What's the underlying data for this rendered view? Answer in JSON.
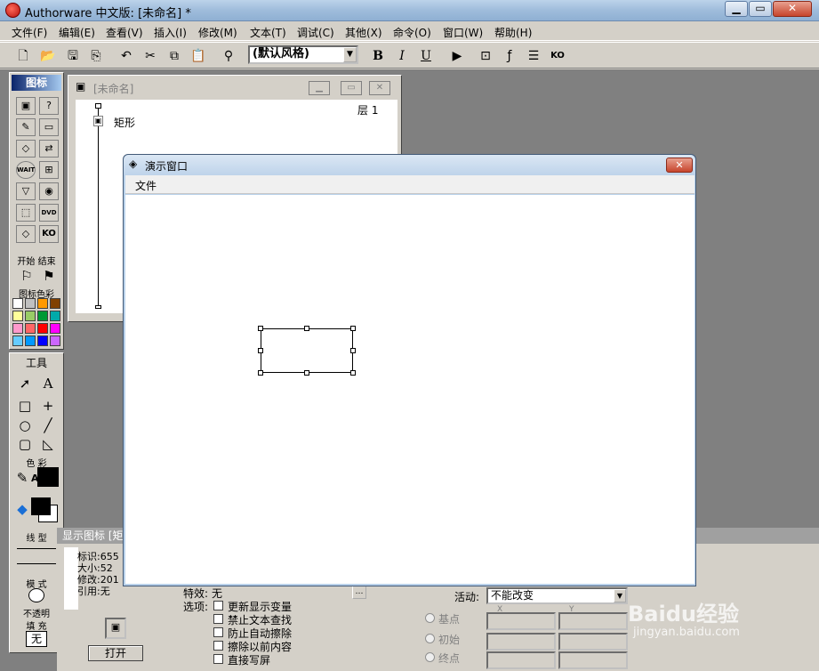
{
  "window": {
    "title": "Authorware 中文版: [未命名] *"
  },
  "menubar": [
    "文件(F)",
    "编辑(E)",
    "查看(V)",
    "插入(I)",
    "修改(M)",
    "文本(T)",
    "调试(C)",
    "其他(X)",
    "命令(O)",
    "窗口(W)",
    "帮助(H)"
  ],
  "toolbar": {
    "style_value": "(默认风格)",
    "bold": "B",
    "italic": "I",
    "underline": "U"
  },
  "icon_palette": {
    "title": "图标",
    "start_label": "开始",
    "end_label": "结束",
    "color_label": "图标色彩",
    "icons": [
      "display-icon",
      "interaction-icon",
      "calculation-icon",
      "map-icon",
      "erase-icon",
      "navigate-icon",
      "wait-icon",
      "framework-icon",
      "decision-icon",
      "digital-movie-icon",
      "motion-icon",
      "sound-icon",
      "video-icon",
      "knowledge-object-icon"
    ],
    "wait_text": "WAIT",
    "dvd_text": "DVD",
    "ko_text": "KO",
    "colors": [
      "#ffffff",
      "#c0c0c0",
      "#ff9900",
      "#804000",
      "#ffff99",
      "#99cc66",
      "#009933",
      "#00aaaa",
      "#ff99cc",
      "#ff6666",
      "#ff0000",
      "#ff00ff",
      "#66ccff",
      "#0099ff",
      "#0000ff",
      "#cc66ff"
    ]
  },
  "tools_palette": {
    "title": "工具",
    "color_label": "色 彩",
    "line_label": "线 型",
    "mode_label": "模 式",
    "mode_value": "不透明",
    "fill_label": "填 充",
    "fill_value": "无",
    "text_tool": "A",
    "pen_text": "A"
  },
  "flow_window": {
    "title": "[未命名]",
    "level": "层 1",
    "icon_label": "矩形"
  },
  "pres_window": {
    "title": "演示窗口",
    "menu": "文件"
  },
  "props": {
    "title": "显示图标 [矩",
    "id": "标识:655",
    "size": "大小:52",
    "modified": "修改:201",
    "ref": "引用:无",
    "effect_label": "特效:",
    "effect_value": "无",
    "options_label": "选项:",
    "options": [
      "更新显示变量",
      "禁止文本查找",
      "防止自动擦除",
      "擦除以前内容",
      "直接写屏"
    ],
    "active_label": "活动:",
    "active_value": "不能改变",
    "radios": [
      "基点",
      "初始",
      "终点"
    ],
    "x_label": "X",
    "y_label": "Y",
    "open_button": "打开"
  },
  "watermark": {
    "brand": "Baidu经验",
    "url": "jingyan.baidu.com"
  }
}
